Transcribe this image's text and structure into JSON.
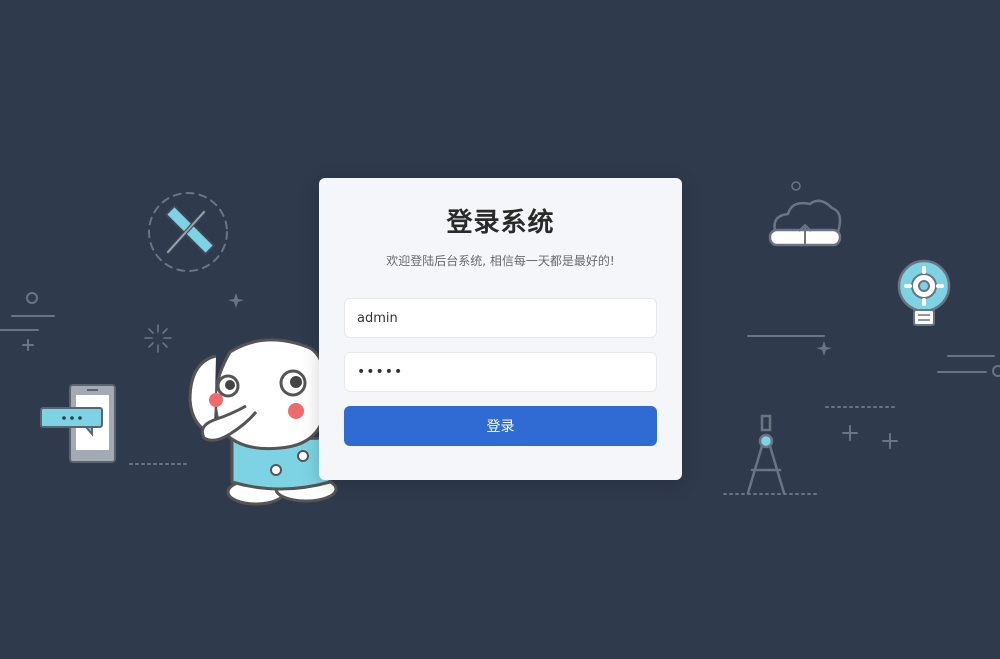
{
  "login": {
    "title": "登录系统",
    "subtitle": "欢迎登陆后台系统, 相信每一天都是最好的!",
    "username_value": "admin",
    "password_value": "•••••",
    "submit_label": "登录"
  },
  "icons": [
    "ruler-pencil-icon",
    "sparkle-icon",
    "sun-burst-icon",
    "phone-chat-icon",
    "elephant-mascot-illustration",
    "cloud-upload-icon",
    "lightbulb-gear-icon",
    "compass-icon",
    "plus-icon"
  ],
  "colors": {
    "background": "#2f3a4c",
    "card": "#f4f6f9",
    "button": "#2f6bd3",
    "accent_teal": "#7dd3e3"
  }
}
